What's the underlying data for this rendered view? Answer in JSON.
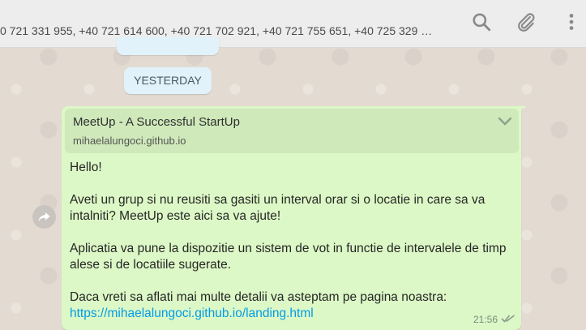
{
  "header": {
    "participants": "0 721 331 955, +40 721 614 600, +40 721 702 921, +40 721 755 651, +40 725 329 …"
  },
  "chat": {
    "date_divider": "YESTERDAY"
  },
  "message": {
    "preview_title": "MeetUp - A Successful StartUp",
    "preview_domain": "mihaelalungoci.github.io",
    "lines": [
      "Hello!",
      "Aveti un grup si nu reusiti sa gasiti un interval orar si o locatie in care sa va",
      "intalniti? MeetUp este aici sa va ajute!",
      "Aplicatia va pune la dispozitie un sistem de  vot in functie de intervalele de timp",
      "alese si de locatiile sugerate.",
      "Daca vreti sa aflati mai multe detalii va asteptam pe pagina noastra:"
    ],
    "link": "https://mihaelalungoci.github.io/landing.html",
    "time": "21:56",
    "status": "double-check-icon"
  },
  "icons": {
    "search": "search-icon",
    "attach": "paperclip-icon",
    "menu": "more-vertical-icon",
    "forward": "forward-icon",
    "chevron": "chevron-down-icon"
  }
}
